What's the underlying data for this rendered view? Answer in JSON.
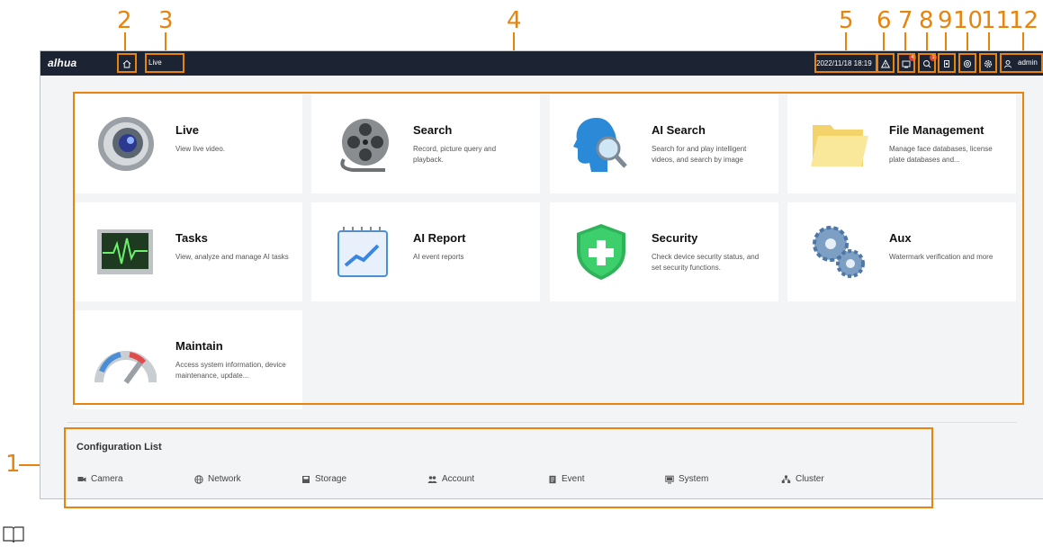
{
  "callouts": [
    "1",
    "2",
    "3",
    "4",
    "5",
    "6",
    "7",
    "8",
    "9",
    "10",
    "11",
    "12"
  ],
  "topbar": {
    "logo": "alhua",
    "home_icon": "home-icon",
    "active_tab": "Live",
    "datetime": "2022/11/18 18:19",
    "icons": [
      "alarm-warning-icon",
      "notification-icon",
      "ai-event-icon",
      "broadcast-icon",
      "storage-settings-icon",
      "settings-icon"
    ],
    "badges": {
      "notification": "4",
      "ai_event": "1"
    },
    "user": "admin"
  },
  "tiles": [
    {
      "title": "Live",
      "desc": "View live video.",
      "icon": "camera-lens-icon"
    },
    {
      "title": "Search",
      "desc": "Record, picture query and playback.",
      "icon": "film-reel-icon"
    },
    {
      "title": "AI Search",
      "desc": "Search for and play intelligent videos, and search by image",
      "icon": "ai-head-magnifier-icon"
    },
    {
      "title": "File Management",
      "desc": "Manage face databases, license plate databases and...",
      "icon": "folder-icon"
    },
    {
      "title": "Tasks",
      "desc": "View, analyze and manage AI tasks",
      "icon": "monitor-waveform-icon"
    },
    {
      "title": "AI Report",
      "desc": "AI event reports",
      "icon": "report-calendar-icon"
    },
    {
      "title": "Security",
      "desc": "Check device security status, and set security functions.",
      "icon": "shield-plus-icon"
    },
    {
      "title": "Aux",
      "desc": "Watermark verification and more",
      "icon": "gears-icon"
    },
    {
      "title": "Maintain",
      "desc": "Access system information, device maintenance, update...",
      "icon": "gauge-icon"
    }
  ],
  "config": {
    "title": "Configuration List",
    "items": [
      {
        "label": "Camera",
        "icon": "camera-icon"
      },
      {
        "label": "Network",
        "icon": "globe-icon"
      },
      {
        "label": "Storage",
        "icon": "storage-icon"
      },
      {
        "label": "Account",
        "icon": "users-icon"
      },
      {
        "label": "Event",
        "icon": "event-icon"
      },
      {
        "label": "System",
        "icon": "system-icon"
      },
      {
        "label": "Cluster",
        "icon": "cluster-icon"
      }
    ]
  },
  "colors": {
    "accent": "#e8830c",
    "topbar": "#1c2333",
    "background": "#f3f4f6",
    "tile": "#ffffff"
  }
}
